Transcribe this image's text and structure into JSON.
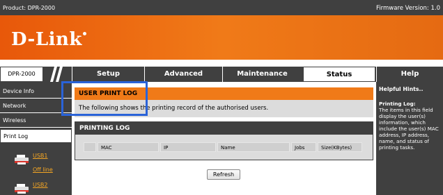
{
  "header": {
    "product": "Product: DPR-2000",
    "firmware": "Firmware Version: 1.0"
  },
  "logo": {
    "text": "D-Link"
  },
  "nav": {
    "model": "DPR-2000",
    "tabs": [
      {
        "label": "Setup"
      },
      {
        "label": "Advanced"
      },
      {
        "label": "Maintenance"
      },
      {
        "label": "Status",
        "active": true
      },
      {
        "label": "Help"
      }
    ]
  },
  "sidebar": {
    "items": [
      {
        "label": "Device Info"
      },
      {
        "label": "Network"
      },
      {
        "label": "Wireless"
      },
      {
        "label": "Print Log",
        "active": true
      }
    ],
    "printers": [
      {
        "name": "USB1",
        "status": "Off line"
      },
      {
        "name": "USB2"
      }
    ]
  },
  "user_print_log": {
    "title": "USER PRINT LOG",
    "description": "The following shows the printing record of the authorised users."
  },
  "printing_log": {
    "title": "PRINTING LOG",
    "columns": [
      "MAC",
      "IP",
      "Name",
      "Jobs",
      "Size(KBytes)"
    ]
  },
  "refresh_label": "Refresh",
  "help": {
    "heading": "Helpful Hints..",
    "topic": "Printing Log:",
    "text": "The items in this field display the user(s) information, which include the user(s) MAC address, IP address, name, and status of printing tasks."
  },
  "colors": {
    "brand_orange": "#f07a18",
    "dark_gray": "#404040",
    "highlight_blue": "#2a63d8"
  }
}
